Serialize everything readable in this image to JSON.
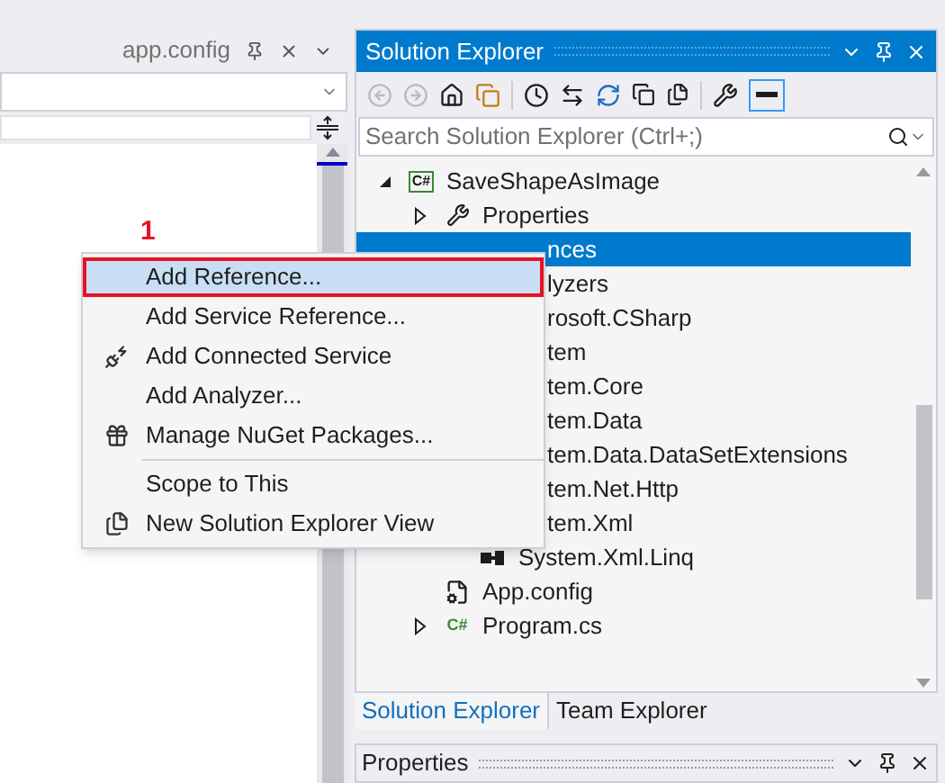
{
  "document_tab": {
    "title": "app.config"
  },
  "annotation": {
    "text": "1"
  },
  "solution_explorer": {
    "title": "Solution Explorer",
    "search": {
      "placeholder": "Search Solution Explorer (Ctrl+;)"
    },
    "tree": [
      {
        "label": "SaveShapeAsImage",
        "kind": "project",
        "icon_text": "C#",
        "expanded": true,
        "selected": false,
        "children": [
          {
            "label": "Properties",
            "kind": "wrench",
            "expanded": false,
            "selected": false
          },
          {
            "label": "nces",
            "selected": true,
            "children": [
              {
                "label": "lyzers",
                "selected": false
              },
              {
                "label": "rosoft.CSharp",
                "selected": false
              },
              {
                "label": "tem",
                "selected": false
              },
              {
                "label": "tem.Core",
                "selected": false
              },
              {
                "label": "tem.Data",
                "selected": false
              },
              {
                "label": "tem.Data.DataSetExtensions",
                "selected": false
              },
              {
                "label": "tem.Net.Http",
                "selected": false
              },
              {
                "label": "tem.Xml",
                "selected": false
              },
              {
                "label": "System.Xml.Linq",
                "kind": "ref",
                "selected": false
              }
            ]
          },
          {
            "label": "App.config",
            "kind": "config",
            "selected": false
          },
          {
            "label": "Program.cs",
            "kind": "csharp",
            "icon_text": "C#",
            "expanded": false,
            "selected": false
          }
        ]
      }
    ],
    "tabs": [
      {
        "label": "Solution Explorer",
        "selected": true
      },
      {
        "label": "Team Explorer",
        "selected": false
      }
    ]
  },
  "properties": {
    "title": "Properties"
  },
  "context_menu": [
    {
      "label": "Add Reference...",
      "kind": "plain",
      "selected": true
    },
    {
      "label": "Add Service Reference...",
      "kind": "plain",
      "selected": false
    },
    {
      "label": "Add Connected Service",
      "kind": "connected",
      "selected": false
    },
    {
      "label": "Add Analyzer...",
      "kind": "plain",
      "selected": false
    },
    {
      "label": "Manage NuGet Packages...",
      "kind": "package",
      "selected": false,
      "separator_after": true
    },
    {
      "label": "Scope to This",
      "kind": "plain",
      "selected": false
    },
    {
      "label": "New Solution Explorer View",
      "kind": "view",
      "selected": false
    }
  ]
}
